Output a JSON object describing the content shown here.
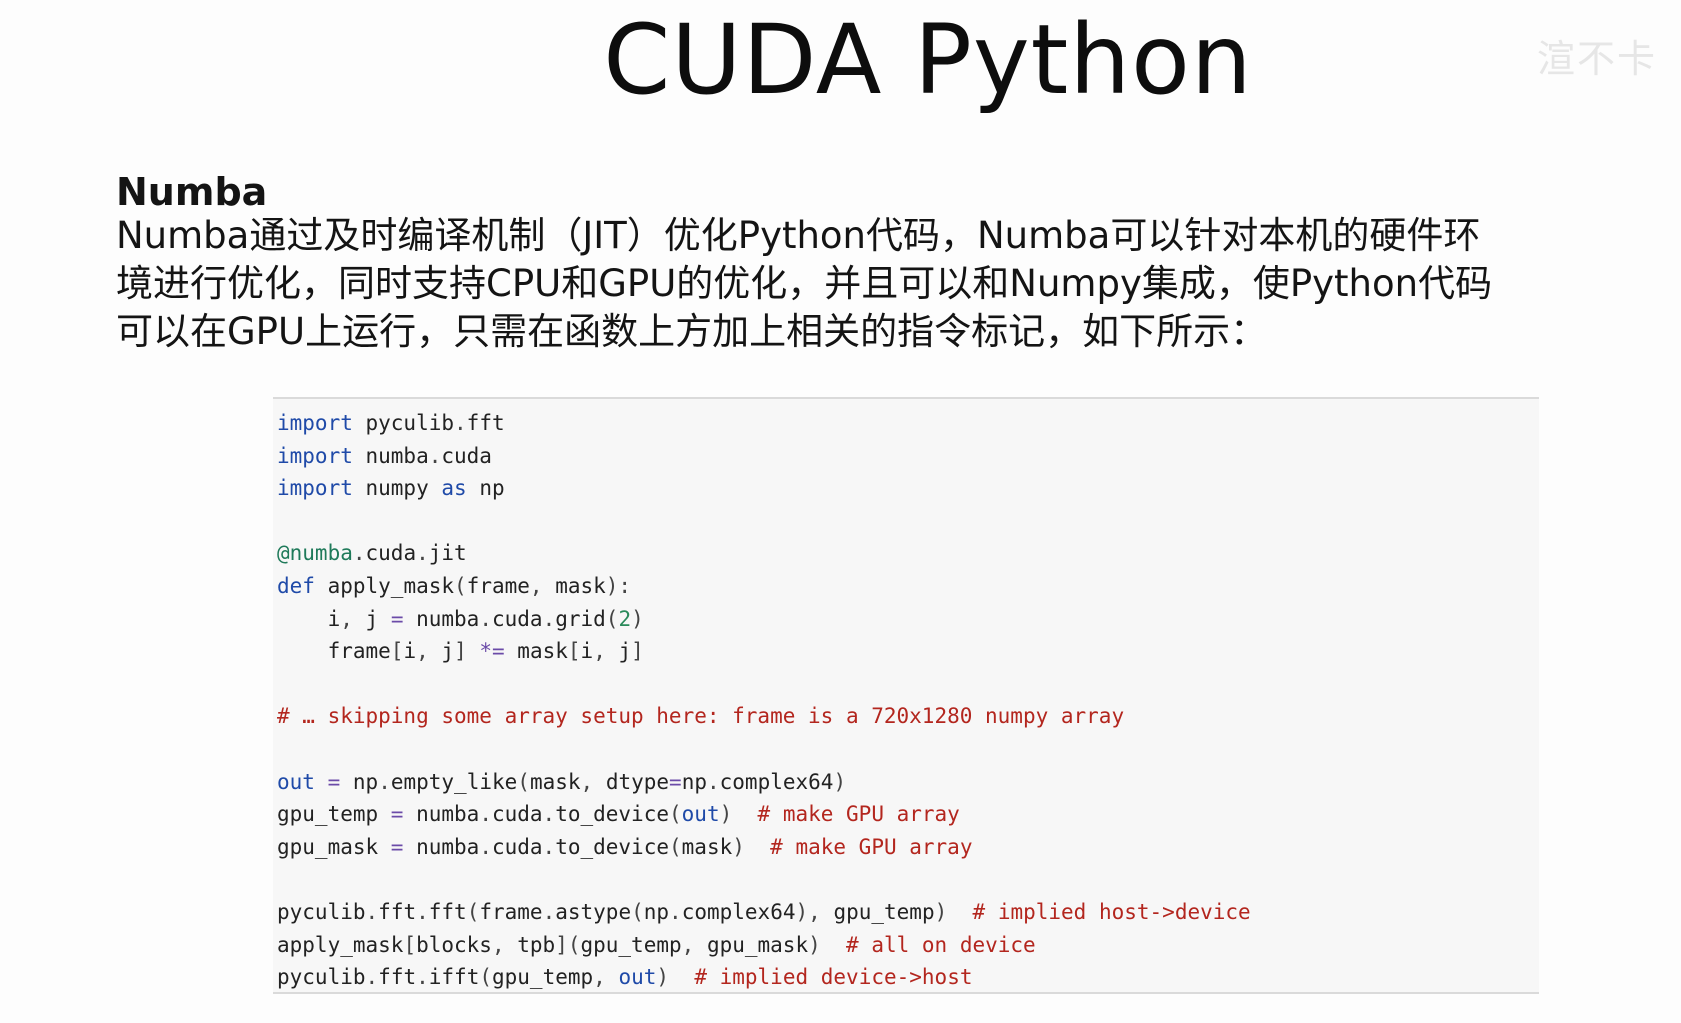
{
  "slide": {
    "title": "CUDA Python",
    "watermark": "渲不卡",
    "section_heading": "Numba",
    "paragraph": "Numba通过及时编译机制（JIT）优化Python代码，Numba可以针对本机的硬件环境进行优化，同时支持CPU和GPU的优化，并且可以和Numpy集成，使Python代码可以在GPU上运行，只需在函数上方加上相关的指令标记，如下所示："
  },
  "code": {
    "lines": [
      [
        {
          "t": "import",
          "c": "kw"
        },
        {
          "t": " pyculib",
          "c": "txt"
        },
        {
          "t": ".",
          "c": "p"
        },
        {
          "t": "fft",
          "c": "txt"
        }
      ],
      [
        {
          "t": "import",
          "c": "kw"
        },
        {
          "t": " numba",
          "c": "txt"
        },
        {
          "t": ".",
          "c": "p"
        },
        {
          "t": "cuda",
          "c": "txt"
        }
      ],
      [
        {
          "t": "import",
          "c": "kw"
        },
        {
          "t": " numpy ",
          "c": "txt"
        },
        {
          "t": "as",
          "c": "kw"
        },
        {
          "t": " np",
          "c": "txt"
        }
      ],
      [],
      [
        {
          "t": "@numba",
          "c": "dec"
        },
        {
          "t": ".",
          "c": "p"
        },
        {
          "t": "cuda",
          "c": "txt"
        },
        {
          "t": ".",
          "c": "p"
        },
        {
          "t": "jit",
          "c": "txt"
        }
      ],
      [
        {
          "t": "def",
          "c": "kw"
        },
        {
          "t": " apply_mask",
          "c": "txt"
        },
        {
          "t": "(",
          "c": "p"
        },
        {
          "t": "frame",
          "c": "txt"
        },
        {
          "t": ", ",
          "c": "p"
        },
        {
          "t": "mask",
          "c": "txt"
        },
        {
          "t": "):",
          "c": "p"
        }
      ],
      [
        {
          "t": "    i",
          "c": "txt"
        },
        {
          "t": ", ",
          "c": "p"
        },
        {
          "t": "j ",
          "c": "txt"
        },
        {
          "t": "=",
          "c": "op"
        },
        {
          "t": " numba",
          "c": "txt"
        },
        {
          "t": ".",
          "c": "p"
        },
        {
          "t": "cuda",
          "c": "txt"
        },
        {
          "t": ".",
          "c": "p"
        },
        {
          "t": "grid",
          "c": "txt"
        },
        {
          "t": "(",
          "c": "p"
        },
        {
          "t": "2",
          "c": "num"
        },
        {
          "t": ")",
          "c": "p"
        }
      ],
      [
        {
          "t": "    frame",
          "c": "txt"
        },
        {
          "t": "[",
          "c": "p"
        },
        {
          "t": "i",
          "c": "txt"
        },
        {
          "t": ", ",
          "c": "p"
        },
        {
          "t": "j",
          "c": "txt"
        },
        {
          "t": "] ",
          "c": "p"
        },
        {
          "t": "*=",
          "c": "op"
        },
        {
          "t": " mask",
          "c": "txt"
        },
        {
          "t": "[",
          "c": "p"
        },
        {
          "t": "i",
          "c": "txt"
        },
        {
          "t": ", ",
          "c": "p"
        },
        {
          "t": "j",
          "c": "txt"
        },
        {
          "t": "]",
          "c": "p"
        }
      ],
      [],
      [
        {
          "t": "# … skipping some array setup here: frame is a 720x1280 numpy array",
          "c": "cm"
        }
      ],
      [],
      [
        {
          "t": "out",
          "c": "bi"
        },
        {
          "t": " ",
          "c": "txt"
        },
        {
          "t": "=",
          "c": "op"
        },
        {
          "t": " np",
          "c": "txt"
        },
        {
          "t": ".",
          "c": "p"
        },
        {
          "t": "empty_like",
          "c": "txt"
        },
        {
          "t": "(",
          "c": "p"
        },
        {
          "t": "mask",
          "c": "txt"
        },
        {
          "t": ", ",
          "c": "p"
        },
        {
          "t": "dtype",
          "c": "txt"
        },
        {
          "t": "=",
          "c": "op"
        },
        {
          "t": "np",
          "c": "txt"
        },
        {
          "t": ".",
          "c": "p"
        },
        {
          "t": "complex64",
          "c": "txt"
        },
        {
          "t": ")",
          "c": "p"
        }
      ],
      [
        {
          "t": "gpu_temp ",
          "c": "txt"
        },
        {
          "t": "=",
          "c": "op"
        },
        {
          "t": " numba",
          "c": "txt"
        },
        {
          "t": ".",
          "c": "p"
        },
        {
          "t": "cuda",
          "c": "txt"
        },
        {
          "t": ".",
          "c": "p"
        },
        {
          "t": "to_device",
          "c": "txt"
        },
        {
          "t": "(",
          "c": "p"
        },
        {
          "t": "out",
          "c": "bi"
        },
        {
          "t": ")  ",
          "c": "p"
        },
        {
          "t": "# make GPU array",
          "c": "cm"
        }
      ],
      [
        {
          "t": "gpu_mask ",
          "c": "txt"
        },
        {
          "t": "=",
          "c": "op"
        },
        {
          "t": " numba",
          "c": "txt"
        },
        {
          "t": ".",
          "c": "p"
        },
        {
          "t": "cuda",
          "c": "txt"
        },
        {
          "t": ".",
          "c": "p"
        },
        {
          "t": "to_device",
          "c": "txt"
        },
        {
          "t": "(",
          "c": "p"
        },
        {
          "t": "mask",
          "c": "txt"
        },
        {
          "t": ")  ",
          "c": "p"
        },
        {
          "t": "# make GPU array",
          "c": "cm"
        }
      ],
      [],
      [
        {
          "t": "pyculib",
          "c": "txt"
        },
        {
          "t": ".",
          "c": "p"
        },
        {
          "t": "fft",
          "c": "txt"
        },
        {
          "t": ".",
          "c": "p"
        },
        {
          "t": "fft",
          "c": "txt"
        },
        {
          "t": "(",
          "c": "p"
        },
        {
          "t": "frame",
          "c": "txt"
        },
        {
          "t": ".",
          "c": "p"
        },
        {
          "t": "astype",
          "c": "txt"
        },
        {
          "t": "(",
          "c": "p"
        },
        {
          "t": "np",
          "c": "txt"
        },
        {
          "t": ".",
          "c": "p"
        },
        {
          "t": "complex64",
          "c": "txt"
        },
        {
          "t": "), ",
          "c": "p"
        },
        {
          "t": "gpu_temp",
          "c": "txt"
        },
        {
          "t": ")  ",
          "c": "p"
        },
        {
          "t": "# implied host->device",
          "c": "cm"
        }
      ],
      [
        {
          "t": "apply_mask",
          "c": "txt"
        },
        {
          "t": "[",
          "c": "p"
        },
        {
          "t": "blocks",
          "c": "txt"
        },
        {
          "t": ", ",
          "c": "p"
        },
        {
          "t": "tpb",
          "c": "txt"
        },
        {
          "t": "](",
          "c": "p"
        },
        {
          "t": "gpu_temp",
          "c": "txt"
        },
        {
          "t": ", ",
          "c": "p"
        },
        {
          "t": "gpu_mask",
          "c": "txt"
        },
        {
          "t": ")  ",
          "c": "p"
        },
        {
          "t": "# all on device",
          "c": "cm"
        }
      ],
      [
        {
          "t": "pyculib",
          "c": "txt"
        },
        {
          "t": ".",
          "c": "p"
        },
        {
          "t": "fft",
          "c": "txt"
        },
        {
          "t": ".",
          "c": "p"
        },
        {
          "t": "ifft",
          "c": "txt"
        },
        {
          "t": "(",
          "c": "p"
        },
        {
          "t": "gpu_temp",
          "c": "txt"
        },
        {
          "t": ", ",
          "c": "p"
        },
        {
          "t": "out",
          "c": "bi"
        },
        {
          "t": ")  ",
          "c": "p"
        },
        {
          "t": "# implied device->host",
          "c": "cm"
        }
      ]
    ]
  }
}
